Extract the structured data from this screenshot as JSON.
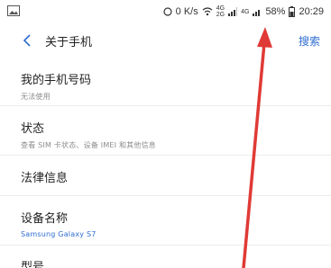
{
  "status_bar": {
    "net_speed": "0 K/s",
    "signal_top": "4G",
    "signal_2g": "2G",
    "signal_4g": "4G",
    "battery": "58%",
    "time": "20:29"
  },
  "app_bar": {
    "title": "关于手机",
    "search_label": "搜索"
  },
  "items": [
    {
      "title": "我的手机号码",
      "subtitle": "无法使用"
    },
    {
      "title": "状态",
      "subtitle": "查看 SIM 卡状态、设备 IMEI 和其他信息"
    },
    {
      "title": "法律信息",
      "subtitle": ""
    },
    {
      "title": "设备名称",
      "subtitle": "Samsung Galaxy S7"
    },
    {
      "title": "型号",
      "subtitle": ""
    }
  ],
  "colors": {
    "accent": "#2f6dd0",
    "annotation_arrow": "#e03a36"
  }
}
